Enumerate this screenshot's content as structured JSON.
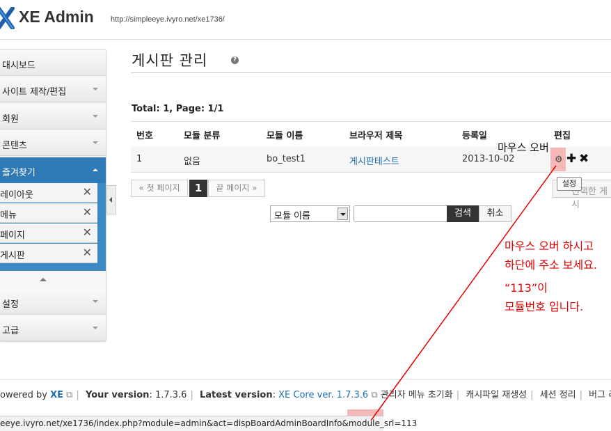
{
  "header": {
    "title": "XE Admin",
    "url": "http://simpleeye.ivyro.net/xe1736/"
  },
  "sidebar": {
    "items": [
      {
        "label": "대시보드"
      },
      {
        "label": "사이트 제작/편집"
      },
      {
        "label": "회원"
      },
      {
        "label": "콘텐츠"
      }
    ],
    "favorites_label": "즐겨찾기",
    "favorites": [
      {
        "label": "레이아웃"
      },
      {
        "label": "메뉴"
      },
      {
        "label": "페이지"
      },
      {
        "label": "게시판"
      }
    ],
    "bottom_items": [
      {
        "label": "설정"
      },
      {
        "label": "고급"
      }
    ],
    "remove_glyph": "✕"
  },
  "main": {
    "page_title": "게시판 관리",
    "help_glyph": "?",
    "total": "Total: 1, Page: 1/1",
    "table": {
      "headers": [
        "번호",
        "모듈 분류",
        "모듈 이름",
        "브라우저 제목",
        "등록일",
        "편집"
      ],
      "rows": [
        {
          "no": "1",
          "category": "없음",
          "module_name": "bo_test1",
          "browser_title": "게시판테스트",
          "date": "2013-10-02"
        }
      ]
    },
    "hover_note": "마우스 오버",
    "tooltip": "설정",
    "right_button": "선택한 게시",
    "pagination": {
      "first": "« 첫 페이지",
      "current": "1",
      "last": "끝 페이지 »"
    },
    "search": {
      "select_value": "모듈 이름",
      "input_value": "",
      "search_label": "검색",
      "cancel_label": "취소"
    }
  },
  "annotation": {
    "line1": "마우스 오버 하시고",
    "line2": "하단에 주소 보세요.",
    "line3": "“113”이",
    "line4": "모듈번호 입니다.",
    "color": "#e00000"
  },
  "footer": {
    "powered_by": "owered by",
    "xe": "XE",
    "your_version_label": "Your version",
    "your_version": "1.7.3.6",
    "latest_version_label": "Latest version",
    "latest_version": "XE Core ver. 1.7.3.6",
    "links": [
      "관리자 메뉴 초기화",
      "캐시파일 재생성",
      "세션 정리",
      "버그 리"
    ]
  },
  "statusbar": {
    "url": "eeye.ivyro.net/xe1736/index.php?module=admin&act=dispBoardAdminBoardInfo&module_srl=113"
  }
}
